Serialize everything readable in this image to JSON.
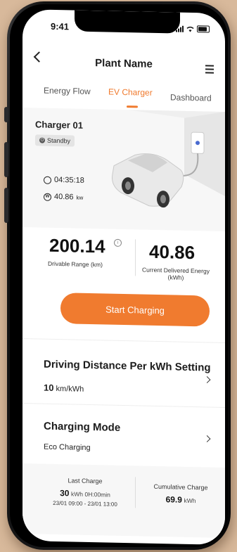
{
  "status_bar": {
    "time": "9:41"
  },
  "header": {
    "title": "Plant Name"
  },
  "tabs": [
    {
      "label": "Energy Flow"
    },
    {
      "label": "EV Charger",
      "active": true
    },
    {
      "label": "Dashboard"
    }
  ],
  "charger": {
    "name": "Charger 01",
    "status": "Standby",
    "duration": "04:35:18",
    "power_value": "40.86",
    "power_unit": "kw"
  },
  "stats": {
    "range_value": "200.14",
    "range_label": "Drivable Range  (km)",
    "energy_value": "40.86",
    "energy_label_line1": "Current Delivered Energy",
    "energy_label_line2": "(kWh)"
  },
  "start_button": "Start Charging",
  "distance_setting": {
    "title": "Driving Distance Per kWh Setting",
    "value": "10",
    "unit": "km/kWh"
  },
  "charging_mode": {
    "title": "Charging Mode",
    "value": "Eco Charging"
  },
  "summary": {
    "last_charge_label": "Last Charge",
    "last_charge_value": "30",
    "last_charge_unit": "kWh",
    "last_charge_duration": "0H:00min",
    "last_charge_range": "23/01 09:00  -  23/01 13:00",
    "cumulative_label": "Cumulative Charge",
    "cumulative_value": "69.9",
    "cumulative_unit": "kWh"
  },
  "colors": {
    "accent": "#f07b2f",
    "background": "#d8b99b"
  }
}
